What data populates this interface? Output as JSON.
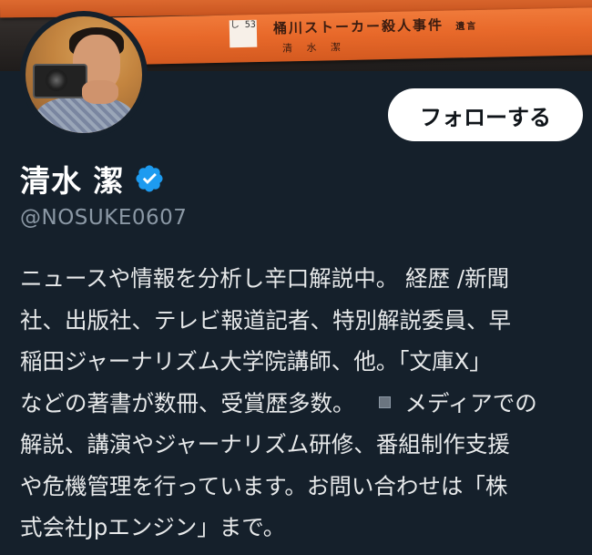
{
  "banner": {
    "book_label": "し 53",
    "book_title": "桶川ストーカー殺人事件",
    "book_subtitle": "遺言",
    "book_author": "清 水 潔"
  },
  "profile": {
    "display_name": "清水 潔",
    "handle": "@NOSUKE0607",
    "verified": true
  },
  "follow_button": {
    "label": "フォローする"
  },
  "bio": {
    "lines": [
      "ニュースや情報を分析し辛口解説中。 経歴 /新聞",
      "社、出版社、テレビ報道記者、特別解説委員、早",
      "稲田ジャーナリズム大学院講師、他。「文庫X」",
      "などの著書が数冊、受賞歴多数。",
      "メディアでの",
      "解説、講演やジャーナリズム研修、番組制作支援",
      "や危機管理を行っています。お問い合わせは「株",
      "式会社Jpエンジン」まで。"
    ],
    "inline_icon": "small-square-icon"
  },
  "colors": {
    "background": "#15202b",
    "verified_blue": "#1d9bf0",
    "secondary_text": "#8b98a5",
    "primary_text": "#e7e9ea"
  }
}
